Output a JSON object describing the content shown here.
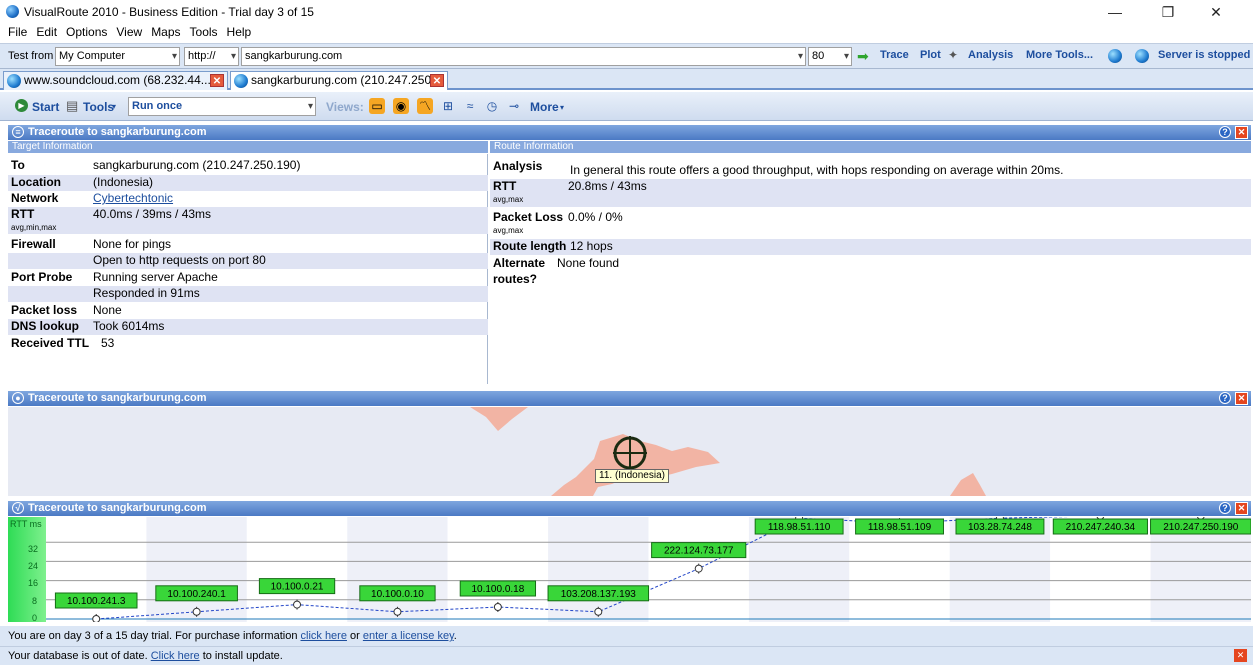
{
  "window": {
    "title": "VisualRoute 2010 - Business Edition - Trial day 3 of 15",
    "minimize": "—",
    "restore": "❐",
    "close": "✕"
  },
  "menu": [
    "File",
    "Edit",
    "Options",
    "View",
    "Maps",
    "Tools",
    "Help"
  ],
  "address_bar": {
    "test_from_label": "Test from",
    "test_from_value": "My Computer",
    "protocol_value": "http://",
    "url_value": "sangkarburung.com",
    "port_value": "80",
    "trace_label": "Trace",
    "plot_label": "Plot",
    "analysis_label": "Analysis",
    "more_tools_label": "More Tools...",
    "server_status": "Server is stopped"
  },
  "tabs": [
    {
      "label": "www.soundcloud.com (68.232.44....",
      "active": false
    },
    {
      "label": "sangkarburung.com (210.247.250....",
      "active": true
    }
  ],
  "toolbar2": {
    "start_label": "Start",
    "tools_label": "Tools",
    "run_mode": "Run once",
    "views_label": "Views:",
    "more_label": "More"
  },
  "panel_info": {
    "header": "Traceroute to sangkarburung.com",
    "target_header": "Target Information",
    "route_header": "Route Information",
    "target": {
      "to_k": "To",
      "to_v": "sangkarburung.com (210.247.250.190)",
      "location_k": "Location",
      "location_v": "(Indonesia)",
      "network_k": "Network",
      "network_v": "Cybertechtonic",
      "rtt_k": "RTT",
      "rtt_v": "40.0ms / 39ms / 43ms",
      "rtt_sub": "avg,min,max",
      "firewall_k": "Firewall",
      "firewall_v1": "None for pings",
      "firewall_v2": "Open to http requests on port 80",
      "probe_k": "Port Probe",
      "probe_v1": "Running server Apache",
      "probe_v2": "Responded in 91ms",
      "loss_k": "Packet loss",
      "loss_v": "None",
      "dns_k": "DNS lookup",
      "dns_v": "Took 6014ms",
      "ttl_k": "Received TTL",
      "ttl_v": "53"
    },
    "route": {
      "analysis_k": "Analysis",
      "analysis_v": "In general this route offers a good throughput, with hops responding on average within 20ms.",
      "rtt_k": "RTT",
      "rtt_v": "20.8ms / 43ms",
      "rtt_sub": "avg,max",
      "loss_k": "Packet Loss",
      "loss_v": "0.0% / 0%",
      "loss_sub": "avg,max",
      "length_k": "Route length",
      "length_v": "12 hops",
      "alt_k1": "Alternate",
      "alt_k2": "routes?",
      "alt_v": "None found"
    }
  },
  "panel_map": {
    "header": "Traceroute to sangkarburung.com",
    "marker_label": "11. (Indonesia)"
  },
  "panel_graph": {
    "header": "Traceroute to sangkarburung.com",
    "axis_unit": "RTT ms",
    "y_ticks": [
      "32",
      "24",
      "16",
      "8",
      "0"
    ]
  },
  "chart_data": {
    "type": "line",
    "ylabel": "RTT ms",
    "ylim": [
      0,
      40
    ],
    "categories": [
      "10.100.241.3",
      "10.100.240.1",
      "10.100.0.21",
      "10.100.0.10",
      "10.100.0.18",
      "103.208.137.193",
      "222.124.73.177",
      "118.98.51.110",
      "118.98.51.109",
      "103.28.74.248",
      "210.247.240.34",
      "210.247.250.190"
    ],
    "values": [
      0,
      3,
      6,
      3,
      5,
      3,
      21,
      42,
      40,
      42,
      43,
      43
    ]
  },
  "footer": {
    "trial_text": "You are on day 3 of a 15 day trial. For purchase information",
    "click_here": "click here",
    "or_text": "or",
    "license_link": "enter a license key",
    "period": ".",
    "db_text": "Your database is out of date.",
    "db_link": "Click here",
    "db_rest": "to install update."
  }
}
